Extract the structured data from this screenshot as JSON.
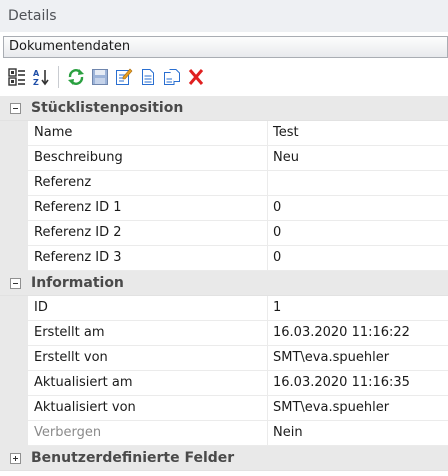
{
  "panel": {
    "title": "Details"
  },
  "document_select": {
    "value": "Dokumentendaten"
  },
  "toolbar": {
    "buttons": [
      {
        "icon": "categorized-view-icon"
      },
      {
        "icon": "sort-alphabetical-icon"
      },
      {
        "icon": "refresh-icon"
      },
      {
        "icon": "save-icon"
      },
      {
        "icon": "edit-icon"
      },
      {
        "icon": "new-document-icon"
      },
      {
        "icon": "copy-document-icon"
      },
      {
        "icon": "delete-icon"
      }
    ]
  },
  "categories": [
    {
      "label": "Stücklistenposition",
      "expanded": true,
      "rows": [
        {
          "key": "Name",
          "value": "Test"
        },
        {
          "key": "Beschreibung",
          "value": "Neu"
        },
        {
          "key": "Referenz",
          "value": ""
        },
        {
          "key": "Referenz ID 1",
          "value": "0"
        },
        {
          "key": "Referenz ID 2",
          "value": "0"
        },
        {
          "key": "Referenz ID 3",
          "value": "0"
        }
      ]
    },
    {
      "label": "Information",
      "expanded": true,
      "rows": [
        {
          "key": "ID",
          "value": "1"
        },
        {
          "key": "Erstellt am",
          "value": "16.03.2020 11:16:22"
        },
        {
          "key": "Erstellt von",
          "value": "SMT\\eva.spuehler"
        },
        {
          "key": "Aktualisiert am",
          "value": "16.03.2020 11:16:35"
        },
        {
          "key": "Aktualisiert von",
          "value": "SMT\\eva.spuehler"
        },
        {
          "key": "Verbergen",
          "value": "Nein",
          "disabled": true
        }
      ]
    },
    {
      "label": "Benutzerdefinierte Felder",
      "expanded": false,
      "rows": []
    }
  ],
  "colors": {
    "delete": "#e02020",
    "refresh": "#2aa040",
    "edit": "#2a6fd1"
  }
}
